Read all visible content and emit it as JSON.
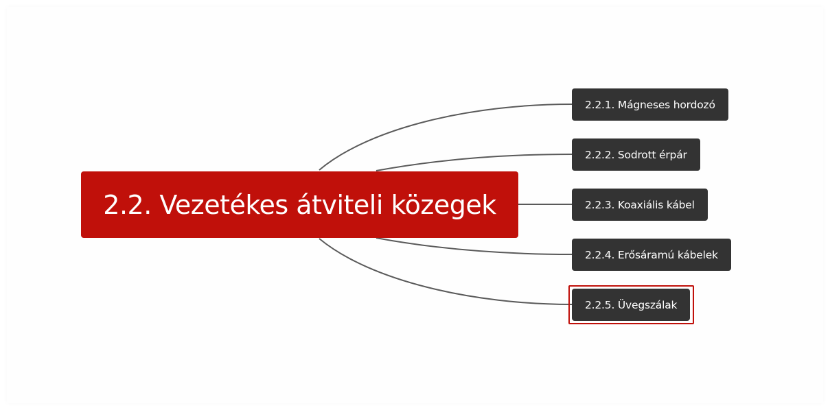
{
  "mindmap": {
    "central": {
      "label": "2.2. Vezetékes átviteli közegek",
      "color": "#c0100a"
    },
    "children": [
      {
        "label": "2.2.1. Mágneses hordozó"
      },
      {
        "label": "2.2.2. Sodrott érpár"
      },
      {
        "label": "2.2.3. Koaxiális kábel"
      },
      {
        "label": "2.2.4. Erősáramú kábelek"
      },
      {
        "label": "2.2.5. Üvegszálak",
        "selected": true
      }
    ],
    "node_color": "#333333",
    "connector_color": "#5a5a5a",
    "selection_color": "#c0100a"
  }
}
